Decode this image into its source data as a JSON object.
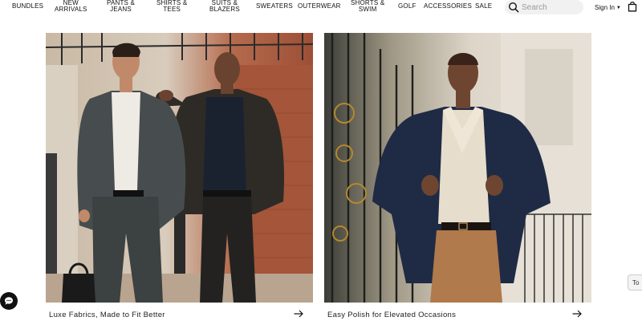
{
  "nav": {
    "items": [
      {
        "label": "BUNDLES",
        "lines": [
          "BUNDLES"
        ]
      },
      {
        "label": "NEW ARRIVALS",
        "lines": [
          "NEW",
          "ARRIVALS"
        ]
      },
      {
        "label": "PANTS & JEANS",
        "lines": [
          "PANTS &",
          "JEANS"
        ]
      },
      {
        "label": "SHIRTS & TEES",
        "lines": [
          "SHIRTS &",
          "TEES"
        ]
      },
      {
        "label": "SUITS & BLAZERS",
        "lines": [
          "SUITS &",
          "BLAZERS"
        ]
      },
      {
        "label": "SWEATERS",
        "lines": [
          "SWEATERS"
        ]
      },
      {
        "label": "OUTERWEAR",
        "lines": [
          "OUTERWEAR"
        ]
      },
      {
        "label": "SHORTS & SWIM",
        "lines": [
          "SHORTS &",
          "SWIM"
        ]
      },
      {
        "label": "GOLF",
        "lines": [
          "GOLF"
        ]
      },
      {
        "label": "ACCESSORIES",
        "lines": [
          "ACCESSORIES"
        ]
      },
      {
        "label": "SALE",
        "lines": [
          "SALE"
        ]
      }
    ],
    "search_placeholder": "Search",
    "signin_label": "Sign In",
    "icons": {
      "search": "search-icon",
      "bag": "shopping-bag-icon",
      "signin_chevron": "chevron-down-icon"
    }
  },
  "cards": [
    {
      "caption": "Luxe Fabrics, Made to Fit Better",
      "icon": "arrow-right-icon"
    },
    {
      "caption": "Easy Polish for Elevated Occasions",
      "icon": "arrow-right-icon"
    }
  ],
  "floating": {
    "chat_icon": "chat-bubble-icon",
    "side_tab_label": "To"
  },
  "colors": {
    "text": "#111111",
    "search_bg": "#f1f1f1",
    "navy_blazer": "#1f2b45",
    "chinos": "#b07a4c"
  }
}
